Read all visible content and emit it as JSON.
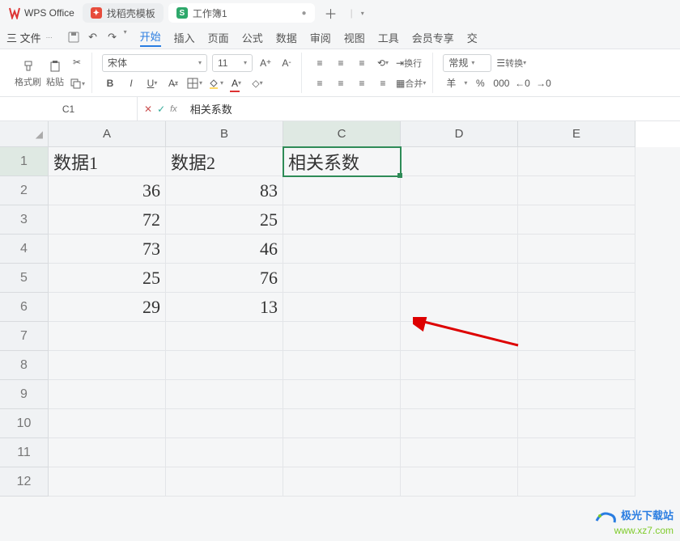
{
  "title_bar": {
    "app_name": "WPS Office",
    "tabs": [
      {
        "label": "找稻壳模板",
        "icon_color": "#e74c3c",
        "icon_text": "✦"
      },
      {
        "label": "工作簿1",
        "icon_color": "#2ea86b",
        "icon_text": "S",
        "active": true
      }
    ],
    "add": "＋"
  },
  "menu": {
    "file": "三 文件",
    "items": [
      "开始",
      "插入",
      "页面",
      "公式",
      "数据",
      "审阅",
      "视图",
      "工具",
      "会员专享",
      "交"
    ]
  },
  "ribbon": {
    "format_painter": "格式刷",
    "paste": "粘贴",
    "font_name": "宋体",
    "font_size": "11",
    "wrap": "换行",
    "merge": "合并",
    "number_format": "常规",
    "convert": "转换",
    "currency": "羊",
    "percent": "%",
    "thousand": "000",
    "dec_inc": ".0",
    "dec_dec": ".00"
  },
  "formula_bar": {
    "cell_ref": "C1",
    "cancel": "✕",
    "confirm": "✓",
    "fx": "fx",
    "value": "相关系数"
  },
  "sheet": {
    "columns": [
      "A",
      "B",
      "C",
      "D",
      "E"
    ],
    "row_count": 12,
    "selected_cell": "C1",
    "data": {
      "A1": "数据1",
      "B1": "数据2",
      "C1": "相关系数",
      "A2": "36",
      "B2": "83",
      "A3": "72",
      "B3": "25",
      "A4": "73",
      "B4": "46",
      "A5": "25",
      "B5": "76",
      "A6": "29",
      "B6": "13"
    }
  },
  "watermark": {
    "line1": "极光下载站",
    "line2": "www.xz7.com"
  }
}
